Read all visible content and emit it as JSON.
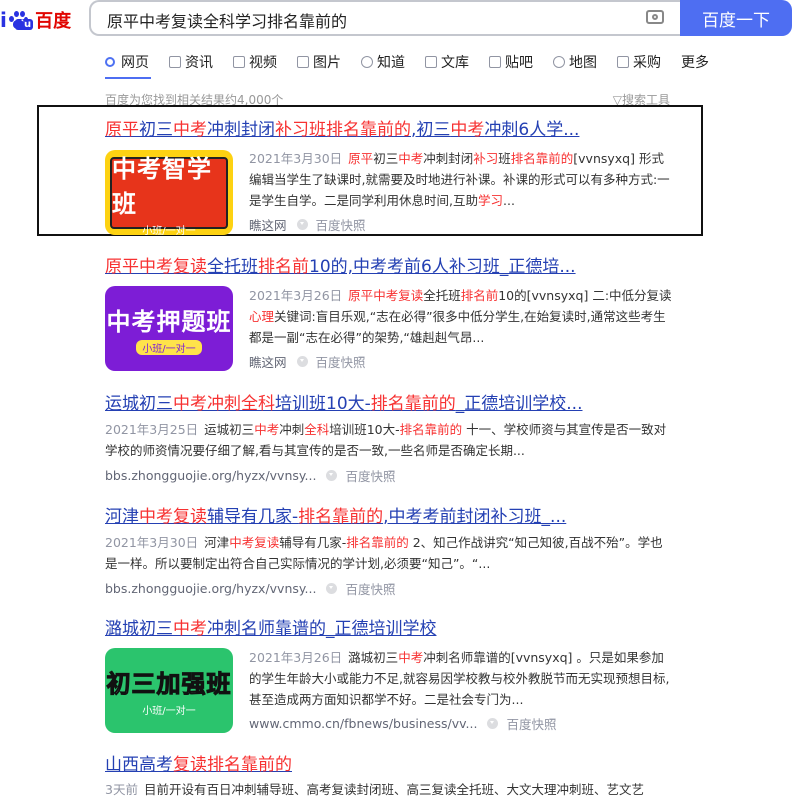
{
  "header": {
    "logo_i": "i",
    "logo_du": "du",
    "logo_cn": "百度",
    "search_value": "原平中考复读全科学习排名靠前的",
    "search_button": "百度一下"
  },
  "nav": {
    "tabs": [
      {
        "label": "网页",
        "icon": "search-icon"
      },
      {
        "label": "资讯",
        "icon": "news-icon"
      },
      {
        "label": "视频",
        "icon": "video-icon"
      },
      {
        "label": "图片",
        "icon": "image-icon"
      },
      {
        "label": "知道",
        "icon": "question-icon"
      },
      {
        "label": "文库",
        "icon": "doc-icon"
      },
      {
        "label": "贴吧",
        "icon": "tieba-icon"
      },
      {
        "label": "地图",
        "icon": "map-icon"
      },
      {
        "label": "采购",
        "icon": "purchase-icon"
      },
      {
        "label": "更多",
        "icon": ""
      }
    ]
  },
  "info": {
    "result_count": "百度为您找到相关结果约4,000个",
    "tools": "▽搜索工具"
  },
  "results": [
    {
      "title": [
        "原平",
        "初三",
        "中考",
        "冲刺封闭",
        "补习班",
        "排名靠前的",
        ",初三",
        "中考",
        "冲刺6人学..."
      ],
      "date": "2021年3月30日",
      "abstract_html": [
        "原平",
        "初三",
        "中考",
        "冲刺封闭",
        "补习",
        "班",
        "排名靠前的",
        "[vvnsyxq] 形式编辑当学生了缺课时,就需要及时地进行补课。补课的形式可以有多种方式:一是学生自学。二是同学利用休息时间,互助",
        "学习",
        "..."
      ],
      "thumb_big": "中考智学班",
      "thumb_small": "小班/一对一",
      "source": "瞧这网",
      "snapshot": "百度快照"
    },
    {
      "title": [
        "原平",
        "中考",
        "复读",
        "全托班",
        "排名前",
        "10的,中考考前6人补习班_正德培..."
      ],
      "date": "2021年3月26日",
      "abstract_html": [
        "原平",
        "中考复读",
        "全托班",
        "排名前",
        "10的[vvnsyxq] 二:中低分复读",
        "心理",
        "关键词:盲目乐观,“志在必得”很多中低分学生,在始复读时,通常这些考生都是一副“志在必得”的架势,“雄赳赳气昂..."
      ],
      "thumb_big": "中考押题班",
      "thumb_small": "小班/一对一",
      "source": "瞧这网",
      "snapshot": "百度快照"
    },
    {
      "title": [
        "运城初三",
        "中考冲刺",
        "全科",
        "培训班10大-",
        "排名靠前的",
        "_正德培训学校..."
      ],
      "date": "2021年3月25日",
      "abstract_html": [
        "运城初三",
        "中考",
        "冲刺",
        "全科",
        "培训班10大-",
        "排名靠前的",
        " 十一、学校师资与其宣传是否一致对学校的师资情况要仔细了解,看与其宣传的是否一致,一些名师是否确定长期..."
      ],
      "source": "bbs.zhongguojie.org/hyzx/vvnsy...",
      "snapshot": "百度快照"
    },
    {
      "title": [
        "河津",
        "中考复读",
        "辅导有几家-",
        "排名靠前的",
        ",中考考前封闭补习班_..."
      ],
      "date": "2021年3月30日",
      "abstract_html": [
        "河津",
        "中考复读",
        "辅导有几家-",
        "排名靠前的",
        " 2、知己作战讲究“知己知彼,百战不殆”。学也是一样。所以要制定出符合自己实际情况的学计划,必须要“知己”。“..."
      ],
      "source": "bbs.zhongguojie.org/hyzx/vvnsy...",
      "snapshot": "百度快照"
    },
    {
      "title": [
        "潞城初三",
        "中考",
        "冲刺名师靠谱的_正德培训学校"
      ],
      "date": "2021年3月26日",
      "abstract_html": [
        "潞城初三",
        "中考",
        "冲刺名师靠谱的[vvnsyxq] 。只是如果参加的学生年龄大小或能力不足,就容易因学校教与校外教脱节而无实现预想目标,甚至造成两方面知识都学不好。二是社会专门为..."
      ],
      "thumb_big": "初三加强班",
      "thumb_small": "小班/一对一",
      "source": "www.cmmo.cn/fbnews/business/vv...",
      "snapshot": "百度快照"
    },
    {
      "title": [
        "山西高考",
        "复读",
        "排名靠前的"
      ],
      "date": "3天前",
      "abstract_html": [
        "目前开设有百日冲刺辅导班、高考复读封闭班、高三复读全托班、大文大理冲刺班、艺文艺"
      ]
    }
  ]
}
